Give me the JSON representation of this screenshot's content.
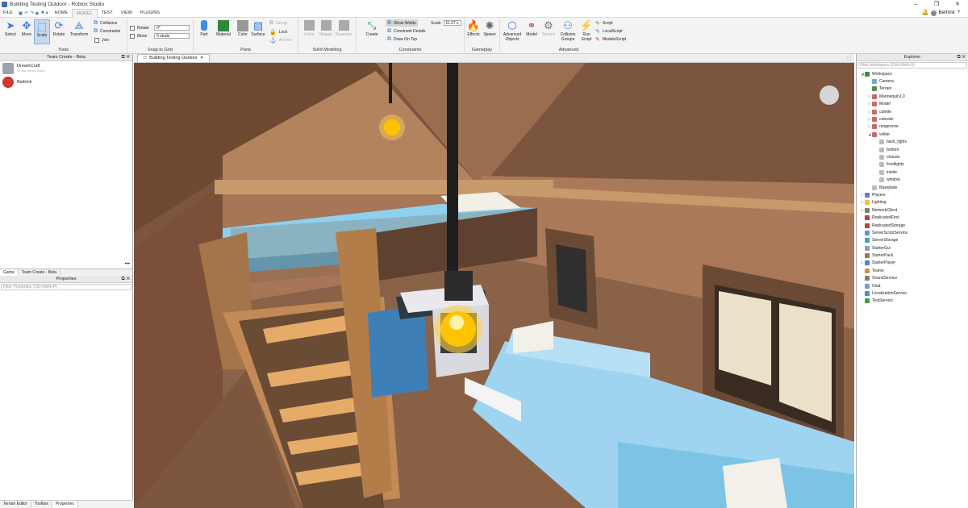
{
  "window": {
    "title": "Building Testing Outdoor - Roblox Studio",
    "controls": [
      "‒",
      "❐",
      "✕"
    ]
  },
  "menu": {
    "file": "FILE",
    "tabs": [
      "HOME",
      "MODEL",
      "TEST",
      "VIEW",
      "PLUGINS"
    ],
    "active": "MODEL",
    "user": "Bethink"
  },
  "ribbon": {
    "tools": {
      "label": "Tools",
      "buttons": [
        "Select",
        "Move",
        "Scale",
        "Rotate",
        "Transform"
      ],
      "collisions": "Collisions",
      "constraints": "Constraints",
      "join": "Join"
    },
    "snap": {
      "label": "Snap to Grid",
      "rotate": "Rotate",
      "rotate_value": "0°",
      "move": "Move",
      "move_value": "0 studs"
    },
    "parts": {
      "label": "Parts",
      "buttons": [
        "Part",
        "Material",
        "Color",
        "Surface"
      ],
      "group": "Group",
      "lock": "Lock",
      "anchor": "Anchor"
    },
    "solid": {
      "label": "Solid Modeling",
      "buttons": [
        "Union",
        "Negate",
        "Separate"
      ]
    },
    "constraints": {
      "label": "Constraints",
      "create": "Create",
      "show_welds": "Show Welds",
      "details": "Constraint Details",
      "draw_on_top": "Draw On Top",
      "scale_label": "Scale",
      "scale_value": "11.37 s"
    },
    "gameplay": {
      "label": "Gameplay",
      "buttons": [
        "Effects",
        "Spawn"
      ]
    },
    "advanced": {
      "label": "Advanced",
      "buttons": [
        "Advanced Objects",
        "Model",
        "Service",
        "Collision Groups",
        "Run Script"
      ],
      "scripts": [
        "Script",
        "LocalScript",
        "ModuleScript"
      ]
    }
  },
  "left": {
    "team_header": "Team Create - Beta",
    "team": [
      {
        "name": "DreamCraft",
        "sub": "Group owned place",
        "color": "#9aa3ad"
      },
      {
        "name": "Bethink",
        "sub": "",
        "color": "#d0392b"
      }
    ],
    "tabs": [
      "Game",
      "Team Create - Beta"
    ],
    "properties_header": "Properties",
    "filter": "Filter Properties (Ctrl+Shift+P)",
    "bottom_tabs": [
      "Terrain Editor",
      "Toolbox",
      "Properties"
    ]
  },
  "viewport": {
    "tab": "Building Testing Outdoor"
  },
  "explorer": {
    "header": "Explorer",
    "filter": "Filter workspace (Ctrl+Shift+X)",
    "items": [
      {
        "label": "Workspace",
        "depth": 0,
        "arrow": "◢",
        "color": "#3d8f3d"
      },
      {
        "label": "Camera",
        "depth": 1,
        "arrow": "",
        "color": "#7aa6d1"
      },
      {
        "label": "Terrain",
        "depth": 1,
        "arrow": "",
        "color": "#5b8c4f"
      },
      {
        "label": "Mannequin1.0",
        "depth": 1,
        "arrow": "▷",
        "color": "#c96a6a"
      },
      {
        "label": "Model",
        "depth": 1,
        "arrow": "▷",
        "color": "#c96a6a"
      },
      {
        "label": "cutette",
        "depth": 1,
        "arrow": "▷",
        "color": "#c96a6a"
      },
      {
        "label": "cutevan",
        "depth": 1,
        "arrow": "▷",
        "color": "#c96a6a"
      },
      {
        "label": "rangerovie",
        "depth": 1,
        "arrow": "▷",
        "color": "#c96a6a"
      },
      {
        "label": "volkie",
        "depth": 1,
        "arrow": "◢",
        "color": "#c96a6a"
      },
      {
        "label": "back_lights",
        "depth": 2,
        "arrow": "",
        "color": "#bbbbbb"
      },
      {
        "label": "bottom",
        "depth": 2,
        "arrow": "",
        "color": "#bbbbbb"
      },
      {
        "label": "chassis",
        "depth": 2,
        "arrow": "",
        "color": "#bbbbbb"
      },
      {
        "label": "frontlights",
        "depth": 2,
        "arrow": "",
        "color": "#bbbbbb"
      },
      {
        "label": "inside",
        "depth": 2,
        "arrow": "",
        "color": "#bbbbbb"
      },
      {
        "label": "window",
        "depth": 2,
        "arrow": "",
        "color": "#bbbbbb"
      },
      {
        "label": "Baseplate",
        "depth": 1,
        "arrow": "",
        "color": "#bbbbbb"
      },
      {
        "label": "Players",
        "depth": 0,
        "arrow": "▷",
        "color": "#5c7fc8"
      },
      {
        "label": "Lighting",
        "depth": 0,
        "arrow": "▷",
        "color": "#e8c33a"
      },
      {
        "label": "NetworkClient",
        "depth": 0,
        "arrow": "▷",
        "color": "#7d7d7d"
      },
      {
        "label": "ReplicatedFirst",
        "depth": 0,
        "arrow": "",
        "color": "#c04040"
      },
      {
        "label": "ReplicatedStorage",
        "depth": 0,
        "arrow": "",
        "color": "#c04040"
      },
      {
        "label": "ServerScriptService",
        "depth": 0,
        "arrow": "",
        "color": "#6a8fd0"
      },
      {
        "label": "ServerStorage",
        "depth": 0,
        "arrow": "",
        "color": "#4aa0c0"
      },
      {
        "label": "StarterGui",
        "depth": 0,
        "arrow": "",
        "color": "#8aa0c0"
      },
      {
        "label": "StarterPack",
        "depth": 0,
        "arrow": "",
        "color": "#9a7a4a"
      },
      {
        "label": "StarterPlayer",
        "depth": 0,
        "arrow": "▷",
        "color": "#5c7fc8"
      },
      {
        "label": "Teams",
        "depth": 0,
        "arrow": "",
        "color": "#d09040"
      },
      {
        "label": "SoundService",
        "depth": 0,
        "arrow": "",
        "color": "#7d7d7d"
      },
      {
        "label": "Chat",
        "depth": 0,
        "arrow": "",
        "color": "#7d9fcf"
      },
      {
        "label": "LocalizationService",
        "depth": 0,
        "arrow": "",
        "color": "#4a8fd0"
      },
      {
        "label": "TestService",
        "depth": 0,
        "arrow": "",
        "color": "#3aa040"
      }
    ]
  }
}
